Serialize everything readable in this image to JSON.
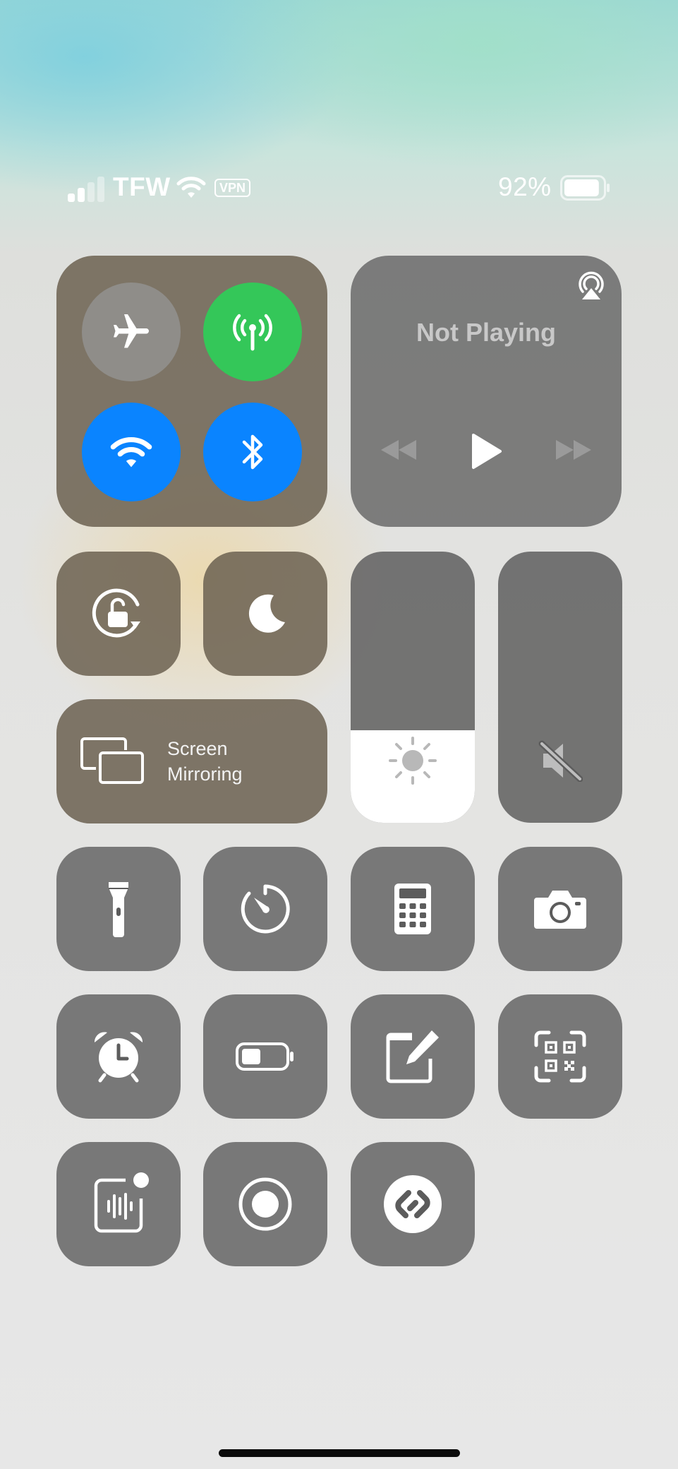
{
  "status_bar": {
    "carrier": "TFW",
    "vpn_badge": "VPN",
    "battery_percent": "92%",
    "signal_bars_active": 2,
    "signal_bars_total": 4,
    "battery_level": 0.92
  },
  "connectivity": {
    "airplane_mode": {
      "icon": "airplane-icon",
      "on": false
    },
    "cellular_data": {
      "icon": "antenna-icon",
      "on": true,
      "color": "#34C759"
    },
    "wifi": {
      "icon": "wifi-icon",
      "on": true,
      "color": "#0A84FF"
    },
    "bluetooth": {
      "icon": "bluetooth-icon",
      "on": true,
      "color": "#0A84FF"
    }
  },
  "media": {
    "now_playing": "Not Playing",
    "airplay_icon": "airplay-icon",
    "controls": [
      "rewind-icon",
      "play-icon",
      "fast-forward-icon"
    ]
  },
  "tiles": {
    "orientation_lock": {
      "icon": "orientation-lock-icon"
    },
    "focus": {
      "icon": "moon-icon"
    },
    "screen_mirroring": {
      "line1": "Screen",
      "line2": "Mirroring",
      "icon": "screen-mirroring-icon"
    }
  },
  "sliders": {
    "brightness": {
      "level": 0.34,
      "icon": "sun-icon"
    },
    "volume": {
      "level": 0.0,
      "icon": "speaker-muted-icon"
    }
  },
  "shortcuts": [
    {
      "name": "flashlight",
      "icon": "flashlight-icon"
    },
    {
      "name": "timer",
      "icon": "timer-icon"
    },
    {
      "name": "calculator",
      "icon": "calculator-icon"
    },
    {
      "name": "camera",
      "icon": "camera-icon"
    },
    {
      "name": "alarm",
      "icon": "alarm-clock-icon"
    },
    {
      "name": "low-power-mode",
      "icon": "battery-icon"
    },
    {
      "name": "quick-note",
      "icon": "note-icon"
    },
    {
      "name": "code-scanner",
      "icon": "qr-code-icon"
    },
    {
      "name": "sound-recognition",
      "icon": "sound-recognition-icon"
    },
    {
      "name": "screen-recording",
      "icon": "record-icon"
    },
    {
      "name": "shazam",
      "icon": "shazam-icon"
    }
  ],
  "colors": {
    "green": "#34C759",
    "blue": "#0A84FF",
    "tile": "#5c5c5c"
  }
}
